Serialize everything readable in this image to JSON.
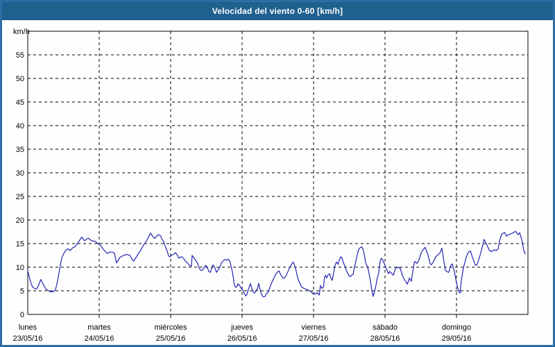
{
  "window": {
    "title": "Velocidad del viento 0-60 [km/h]"
  },
  "colors": {
    "title_bar_bg": "#1f608f",
    "title_text": "#ffffff",
    "outer_border": "#2d6da3",
    "plot_bg": "#fefefe",
    "grid": "#000000",
    "line": "#2323b4"
  },
  "chart_data": {
    "type": "line",
    "title": "Velocidad del viento 0-60 [km/h]",
    "xlabel": "",
    "ylabel": "km/h",
    "ylim": [
      0,
      60
    ],
    "yticks": [
      0,
      5,
      10,
      15,
      20,
      25,
      30,
      35,
      40,
      45,
      50,
      55
    ],
    "grid": "dashed",
    "legend_position": "none",
    "x_unit": "hours since 23/05/16 00:00",
    "xlim": [
      0,
      168
    ],
    "x_day_ticks": [
      {
        "hour": 0,
        "day": "lunes",
        "date": "23/05/16"
      },
      {
        "hour": 24,
        "day": "martes",
        "date": "24/05/16"
      },
      {
        "hour": 48,
        "day": "miércoles",
        "date": "25/05/16"
      },
      {
        "hour": 72,
        "day": "jueves",
        "date": "26/05/16"
      },
      {
        "hour": 96,
        "day": "viernes",
        "date": "27/05/16"
      },
      {
        "hour": 120,
        "day": "sábado",
        "date": "28/05/16"
      },
      {
        "hour": 144,
        "day": "domingo",
        "date": "29/05/16"
      }
    ],
    "series": [
      {
        "name": "Velocidad del viento [km/h]",
        "points": [
          [
            0,
            9.2
          ],
          [
            0.7,
            7.5
          ],
          [
            1.2,
            6.4
          ],
          [
            1.6,
            5.8
          ],
          [
            2.3,
            5.5
          ],
          [
            3,
            5.4
          ],
          [
            3.7,
            6.3
          ],
          [
            4.4,
            7.4
          ],
          [
            5.4,
            6.1
          ],
          [
            6.1,
            5.4
          ],
          [
            7,
            5
          ],
          [
            7.7,
            4.8
          ],
          [
            8.6,
            4.8
          ],
          [
            9.3,
            5.2
          ],
          [
            10,
            7
          ],
          [
            10.7,
            9.5
          ],
          [
            11.4,
            11.9
          ],
          [
            12.1,
            12.9
          ],
          [
            12.8,
            13.6
          ],
          [
            13.5,
            13.9
          ],
          [
            14.2,
            13.5
          ],
          [
            15.1,
            14.1
          ],
          [
            15.8,
            14.3
          ],
          [
            16.8,
            15.1
          ],
          [
            17.5,
            15.8
          ],
          [
            18.2,
            16.4
          ],
          [
            18.6,
            16
          ],
          [
            19.1,
            15.6
          ],
          [
            19.8,
            16
          ],
          [
            20.5,
            16.1
          ],
          [
            21.4,
            15.6
          ],
          [
            22.6,
            15.5
          ],
          [
            23.5,
            15
          ],
          [
            24.5,
            14.6
          ],
          [
            25.2,
            13.9
          ],
          [
            26.1,
            13.3
          ],
          [
            26.8,
            12.9
          ],
          [
            27.5,
            13.2
          ],
          [
            28.4,
            13.2
          ],
          [
            29.1,
            13
          ],
          [
            29.8,
            10.9
          ],
          [
            31,
            12.1
          ],
          [
            32.2,
            12.5
          ],
          [
            33.3,
            12.7
          ],
          [
            34.3,
            12.5
          ],
          [
            35.2,
            11.5
          ],
          [
            35.6,
            11.3
          ],
          [
            36.8,
            12.5
          ],
          [
            37.7,
            13.4
          ],
          [
            38.4,
            14.1
          ],
          [
            39.1,
            14.9
          ],
          [
            40.1,
            15.8
          ],
          [
            40.8,
            16.7
          ],
          [
            41.2,
            17.2
          ],
          [
            41.9,
            16.6
          ],
          [
            42.6,
            16.1
          ],
          [
            43.1,
            16.4
          ],
          [
            43.8,
            16.9
          ],
          [
            44.5,
            16.7
          ],
          [
            45,
            16.1
          ],
          [
            45.7,
            15.3
          ],
          [
            46.1,
            14.6
          ],
          [
            46.8,
            13.5
          ],
          [
            47.3,
            12.4
          ],
          [
            47.8,
            12.2
          ],
          [
            48.5,
            12.6
          ],
          [
            49.2,
            12.8
          ],
          [
            49.6,
            13.1
          ],
          [
            50.3,
            12.5
          ],
          [
            50.8,
            11.9
          ],
          [
            51.5,
            12.2
          ],
          [
            52,
            12.1
          ],
          [
            52.7,
            11.5
          ],
          [
            53.1,
            11.2
          ],
          [
            53.8,
            10.8
          ],
          [
            54.5,
            10.3
          ],
          [
            55,
            10.2
          ],
          [
            55.2,
            12.5
          ],
          [
            55.9,
            11.9
          ],
          [
            56.6,
            11.3
          ],
          [
            57.1,
            10.7
          ],
          [
            57.6,
            9.8
          ],
          [
            58,
            9.4
          ],
          [
            58.5,
            9.3
          ],
          [
            59.2,
            9.8
          ],
          [
            59.7,
            10.4
          ],
          [
            60.3,
            10
          ],
          [
            60.8,
            9.1
          ],
          [
            61.3,
            8.9
          ],
          [
            62.2,
            10.5
          ],
          [
            62.7,
            10.1
          ],
          [
            63.4,
            8.9
          ],
          [
            63.8,
            9.3
          ],
          [
            64.5,
            10
          ],
          [
            65,
            10.9
          ],
          [
            65.7,
            11.4
          ],
          [
            66.2,
            11.6
          ],
          [
            66.9,
            11.5
          ],
          [
            67.3,
            11.7
          ],
          [
            67.8,
            11.4
          ],
          [
            68.3,
            10.2
          ],
          [
            68.7,
            9.1
          ],
          [
            69.2,
            7.2
          ],
          [
            69.4,
            6.2
          ],
          [
            69.9,
            5.7
          ],
          [
            70.4,
            6
          ],
          [
            70.6,
            6.5
          ],
          [
            71.1,
            6.2
          ],
          [
            71.5,
            5.7
          ],
          [
            72,
            5.2
          ],
          [
            72.2,
            5.1
          ],
          [
            72.7,
            4.5
          ],
          [
            73.2,
            3.9
          ],
          [
            73.6,
            4.2
          ],
          [
            74.1,
            5.3
          ],
          [
            74.6,
            6.2
          ],
          [
            74.8,
            6.5
          ],
          [
            75.3,
            5.4
          ],
          [
            75.7,
            4.8
          ],
          [
            76.2,
            4.5
          ],
          [
            76.7,
            5.1
          ],
          [
            77.1,
            5.4
          ],
          [
            77.6,
            6.6
          ],
          [
            77.8,
            5.9
          ],
          [
            78.3,
            4.6
          ],
          [
            78.7,
            4
          ],
          [
            79.2,
            3.7
          ],
          [
            79.7,
            3.8
          ],
          [
            80.2,
            4.4
          ],
          [
            80.9,
            4.8
          ],
          [
            81.3,
            5.7
          ],
          [
            81.8,
            6.5
          ],
          [
            82.3,
            7.2
          ],
          [
            83.2,
            8.4
          ],
          [
            83.9,
            9
          ],
          [
            84.4,
            9.2
          ],
          [
            84.8,
            8.6
          ],
          [
            85.5,
            7.9
          ],
          [
            86,
            7.6
          ],
          [
            86.7,
            8.1
          ],
          [
            87.4,
            9.1
          ],
          [
            88.1,
            10.1
          ],
          [
            88.8,
            10.8
          ],
          [
            89.2,
            11.1
          ],
          [
            89.7,
            10.2
          ],
          [
            90.2,
            9.1
          ],
          [
            90.6,
            7.9
          ],
          [
            91.1,
            7
          ],
          [
            91.6,
            6.3
          ],
          [
            92,
            5.8
          ],
          [
            92.5,
            5.6
          ],
          [
            93.2,
            5.4
          ],
          [
            93.9,
            5.2
          ],
          [
            94.4,
            5.1
          ],
          [
            95.1,
            4.8
          ],
          [
            95.8,
            4.4
          ],
          [
            96.2,
            4.5
          ],
          [
            96.7,
            4.3
          ],
          [
            97.2,
            4.6
          ],
          [
            97.9,
            4.1
          ],
          [
            98.3,
            6.1
          ],
          [
            98.8,
            5.5
          ],
          [
            99.3,
            5.8
          ],
          [
            99.7,
            7.9
          ],
          [
            100,
            8.3
          ],
          [
            100.4,
            7.7
          ],
          [
            100.9,
            8.4
          ],
          [
            101.4,
            8.6
          ],
          [
            101.8,
            7.7
          ],
          [
            102.3,
            7.2
          ],
          [
            102.7,
            8.8
          ],
          [
            103.2,
            10.4
          ],
          [
            103.7,
            11.1
          ],
          [
            104.2,
            10.6
          ],
          [
            104.6,
            11.4
          ],
          [
            105.1,
            12.2
          ],
          [
            105.5,
            12
          ],
          [
            106,
            11
          ],
          [
            106.5,
            10.2
          ],
          [
            106.9,
            9.4
          ],
          [
            107.4,
            8.8
          ],
          [
            107.9,
            8.2
          ],
          [
            108.3,
            8
          ],
          [
            108.8,
            8.3
          ],
          [
            109.3,
            8.5
          ],
          [
            109.7,
            10
          ],
          [
            110.2,
            11.2
          ],
          [
            110.7,
            12.7
          ],
          [
            111.1,
            13.7
          ],
          [
            111.6,
            14.1
          ],
          [
            112.1,
            14.3
          ],
          [
            112.5,
            14
          ],
          [
            113,
            12.8
          ],
          [
            113.5,
            10.9
          ],
          [
            114.2,
            10
          ],
          [
            114.6,
            8.8
          ],
          [
            115.1,
            7
          ],
          [
            115.6,
            5.1
          ],
          [
            116,
            3.8
          ],
          [
            116.5,
            4.9
          ],
          [
            117,
            6.3
          ],
          [
            117.4,
            7.7
          ],
          [
            117.9,
            8.9
          ],
          [
            118.4,
            11.4
          ],
          [
            118.8,
            11.9
          ],
          [
            119.3,
            11.4
          ],
          [
            120,
            10.4
          ],
          [
            120.5,
            9.6
          ],
          [
            121.2,
            8.6
          ],
          [
            121.6,
            9.1
          ],
          [
            122.3,
            8.6
          ],
          [
            122.8,
            8.3
          ],
          [
            123.5,
            9.7
          ],
          [
            124.2,
            10
          ],
          [
            125.1,
            9.8
          ],
          [
            125.8,
            8.3
          ],
          [
            126.5,
            7.4
          ],
          [
            127,
            6.9
          ],
          [
            127.5,
            6.4
          ],
          [
            128.2,
            7.7
          ],
          [
            128.8,
            7
          ],
          [
            129.8,
            10.9
          ],
          [
            130,
            11.2
          ],
          [
            130.7,
            10.8
          ],
          [
            131.4,
            11.5
          ],
          [
            132.1,
            13
          ],
          [
            132.8,
            13.7
          ],
          [
            133.5,
            14.2
          ],
          [
            134.5,
            12.5
          ],
          [
            135.1,
            10.8
          ],
          [
            135.6,
            10.5
          ],
          [
            136.3,
            11.2
          ],
          [
            137,
            12.2
          ],
          [
            137.9,
            12.7
          ],
          [
            138.4,
            13
          ],
          [
            139.1,
            14
          ],
          [
            139.8,
            11.1
          ],
          [
            140.3,
            9.3
          ],
          [
            141,
            9
          ],
          [
            141.4,
            8.9
          ],
          [
            142.1,
            10.4
          ],
          [
            142.6,
            10.7
          ],
          [
            143.3,
            9
          ],
          [
            144,
            6.7
          ],
          [
            144.5,
            5.5
          ],
          [
            144.9,
            4.7
          ],
          [
            145.2,
            4.5
          ],
          [
            145.6,
            7.1
          ],
          [
            146.3,
            9.8
          ],
          [
            147.3,
            12.2
          ],
          [
            148,
            13.2
          ],
          [
            148.7,
            13.4
          ],
          [
            149.4,
            12
          ],
          [
            149.8,
            11.4
          ],
          [
            150.3,
            10.4
          ],
          [
            151,
            10.6
          ],
          [
            151.9,
            12.5
          ],
          [
            152.6,
            14.1
          ],
          [
            153.3,
            15.9
          ],
          [
            154.3,
            14.6
          ],
          [
            155,
            13.6
          ],
          [
            155.7,
            13.3
          ],
          [
            156.6,
            13.7
          ],
          [
            157.3,
            13.5
          ],
          [
            158,
            13.9
          ],
          [
            158.4,
            15.4
          ],
          [
            159.1,
            16.9
          ],
          [
            160.1,
            17.4
          ],
          [
            160.8,
            16.6
          ],
          [
            161.5,
            16.9
          ],
          [
            162.4,
            17.1
          ],
          [
            163.1,
            17.3
          ],
          [
            163.8,
            17.6
          ],
          [
            164.7,
            16.9
          ],
          [
            165.2,
            17.3
          ],
          [
            165.9,
            15.9
          ],
          [
            166.1,
            15.2
          ],
          [
            166.6,
            13.6
          ],
          [
            167.1,
            12.8
          ]
        ]
      }
    ]
  }
}
